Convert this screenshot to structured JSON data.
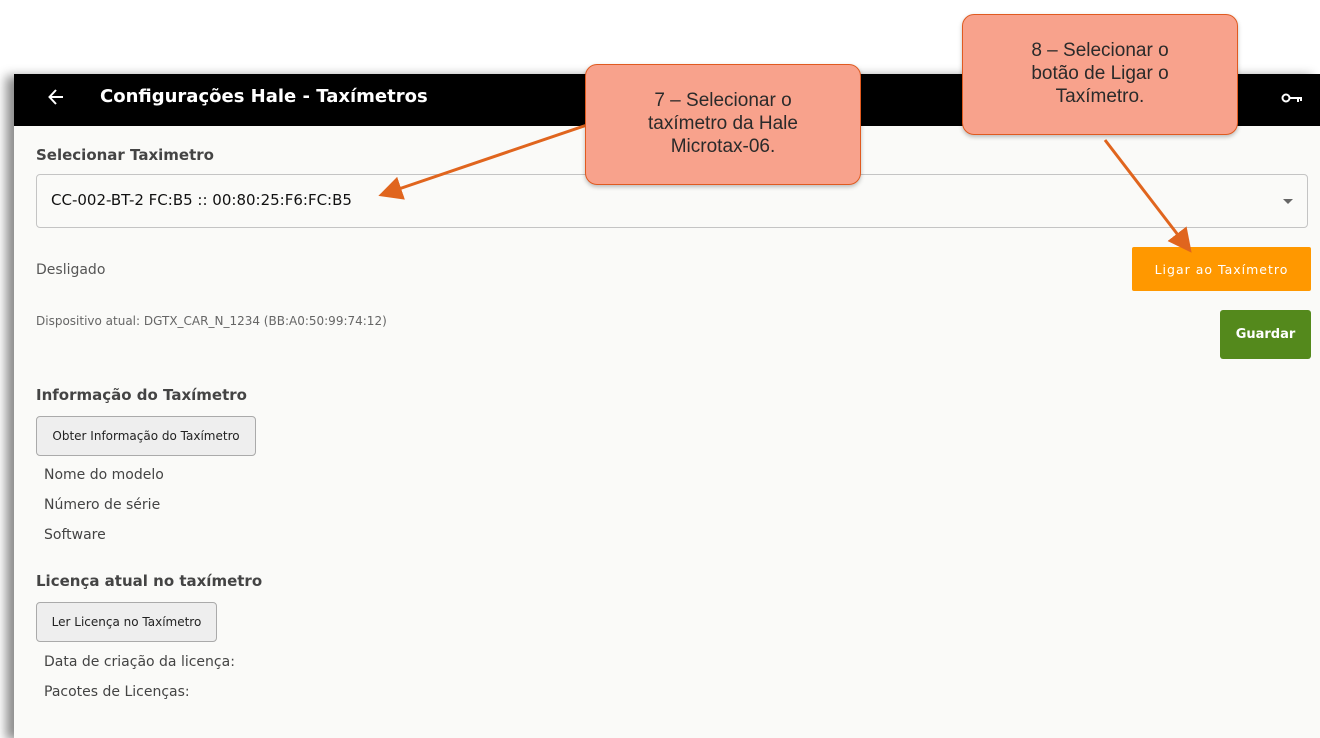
{
  "app": {
    "title": "Configurações Hale - Taxímetros"
  },
  "selector": {
    "label": "Selecionar Taximetro",
    "value": "CC-002-BT-2 FC:B5 :: 00:80:25:F6:FC:B5"
  },
  "connection": {
    "status": "Desligado",
    "connect_label": "Ligar ao Taxímetro",
    "device_text": "Dispositivo atual: DGTX_CAR_N_1234 (BB:A0:50:99:74:12)",
    "save_label": "Guardar"
  },
  "taximeter_info": {
    "heading": "Informação do Taxímetro",
    "button_label": "Obter Informação do Taxímetro",
    "fields": [
      "Nome do modelo",
      "Número de série",
      "Software"
    ]
  },
  "license": {
    "heading": "Licença atual no taxímetro",
    "button_label": "Ler Licença no Taxímetro",
    "fields": [
      "Data de criação da licença:",
      "Pacotes de Licenças:"
    ]
  },
  "callouts": {
    "step7": [
      "7 – Selecionar o",
      "taxímetro da Hale",
      "Microtax-06."
    ],
    "step8": [
      "8 – Selecionar o",
      "botão de Ligar o",
      "Taxímetro."
    ]
  },
  "colors": {
    "connect_button": "#ff9800",
    "save_button": "#54891c",
    "callout_fill": "#f8a28c",
    "arrow": "#e0651e"
  },
  "icons": {
    "back": "back-arrow-icon",
    "key": "key-icon",
    "dropdown": "chevron-down-icon"
  }
}
